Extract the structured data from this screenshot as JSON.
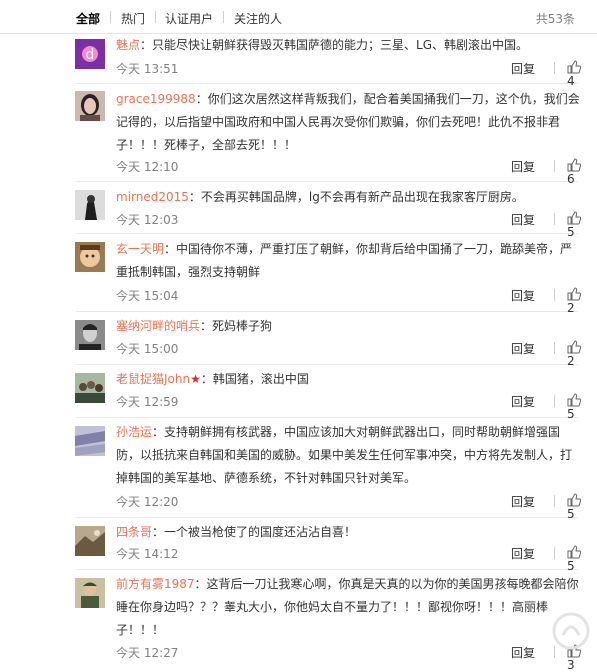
{
  "tabs": [
    "全部",
    "热门",
    "认证用户",
    "关注的人"
  ],
  "total": "共53条",
  "reply_label": "回复",
  "comments": [
    {
      "user": "魅点",
      "text": "：只能尽快让朝鲜获得毁灭韩国萨德的能力；三星、LG、韩剧滚出中国。",
      "lines": [],
      "time": "今天 13:51",
      "likes": "4",
      "avatar_icon": "meizu-logo-avatar"
    },
    {
      "user": "grace199988",
      "text": "：你们这次居然这样背叛我们，配合着美国捅我们一刀，这个仇，我们会",
      "lines": [
        "记得的，以后指望中国政府和中国人民再次受你们欺骗，你们去死吧！此仇不报非君",
        "子！！！死棒子，全部去死！！！"
      ],
      "time": "今天 12:10",
      "likes": "6",
      "avatar_icon": "woman-portrait-avatar"
    },
    {
      "user": "mirned2015",
      "text": "：不会再买韩国品牌，lg不会再有新产品出现在我家客厅厨房。",
      "lines": [],
      "time": "今天 12:03",
      "likes": "5",
      "avatar_icon": "dark-figure-avatar"
    },
    {
      "user": "玄一天明",
      "text": "：中国待你不薄，严重打压了朝鲜，你却背后给中国捅了一刀，跪舔美帝，严",
      "lines": [
        "重抵制韩国，强烈支持朝鲜"
      ],
      "time": "今天 15:04",
      "likes": "2",
      "avatar_icon": "child-photo-avatar"
    },
    {
      "user": "塞纳河畔的哨兵",
      "text": "：死妈棒子狗",
      "lines": [],
      "time": "今天 15:00",
      "likes": "2",
      "avatar_icon": "man-bw-avatar"
    },
    {
      "user": "老鼠捉猫John",
      "text": "：韩国猪，滚出中国",
      "lines": [],
      "time": "今天 12:59",
      "likes": "5",
      "avatar_icon": "group-photo-avatar",
      "badge": "★"
    },
    {
      "user": "孙浩运",
      "text": "：支持朝鲜拥有核武器，中国应该加大对朝鲜武器出口，同时帮助朝鲜增强国",
      "lines": [
        "防，以抵抗来自韩国和美国的威胁。如果中美发生任何军事冲突，中方将先发制人，打",
        "掉韩国的美军基地、萨德系统，不针对韩国只针对美军。"
      ],
      "time": "今天 12:20",
      "likes": "5",
      "avatar_icon": "pattern-avatar"
    },
    {
      "user": "四条哥",
      "text": "：一个被当枪使了的国度还沾沾自喜！",
      "lines": [],
      "time": "今天 14:12",
      "likes": "5",
      "avatar_icon": "landscape-avatar"
    },
    {
      "user": "前方有雾1987",
      "text": "：这背后一刀让我寒心啊，你真是天真的以为你的美国男孩每晚都会陪你",
      "lines": [
        "睡在你身边吗？？？睾丸大小，你他妈太自不量力了！！！鄙视你呀！！！高丽棒",
        "子！！！"
      ],
      "time": "今天 12:27",
      "likes": "3",
      "avatar_icon": "soldier-avatar"
    }
  ]
}
